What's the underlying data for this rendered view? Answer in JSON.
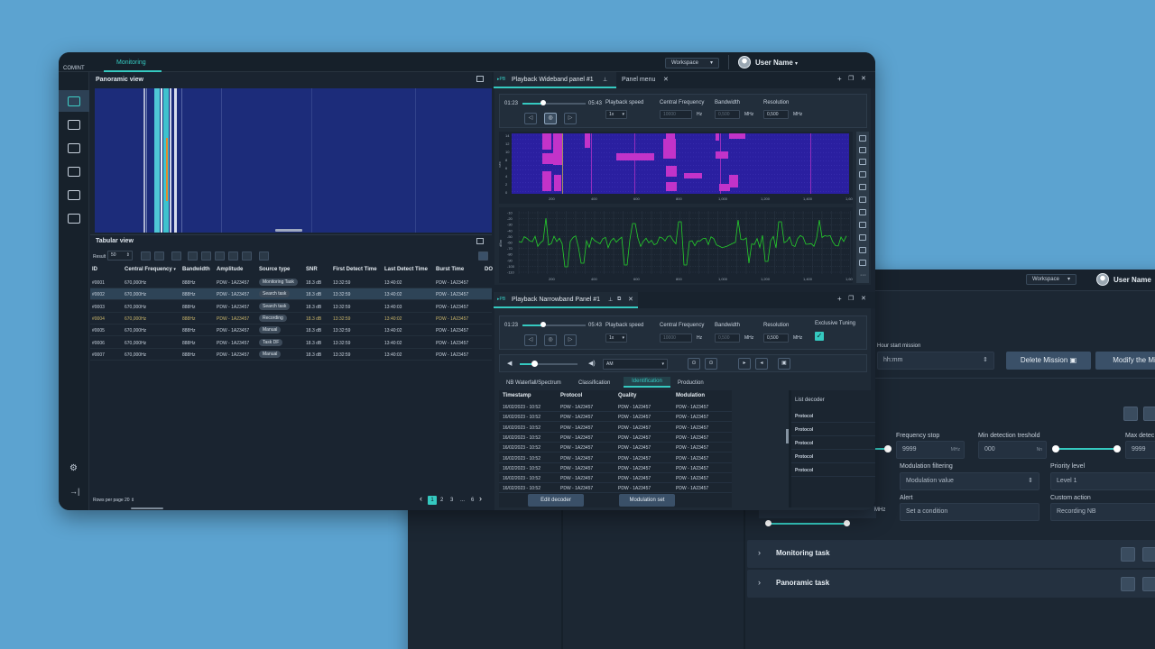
{
  "back": {
    "workspace": "Workspace",
    "user_name": "User Name",
    "hour_label": "Hour start mission",
    "hour_value": "hh:mm",
    "delete_btn": "Delete Mission",
    "modify_btn": "Modify the Mis",
    "freq_stop_label": "Frequency stop",
    "freq_stop_value": "9999",
    "freq_stop_unit": "MHz",
    "min_det_label": "Min detection treshold",
    "min_det_value": "000",
    "min_det_unit": "Nn",
    "max_det_label": "Max detec",
    "max_det_value": "9999",
    "mod_filter_label": "Modulation filtering",
    "mod_filter_value": "Modulation value",
    "priority_label": "Priority level",
    "priority_value": "Level 1",
    "alert_label": "Alert",
    "alert_value": "Set a condition",
    "custom_label": "Custom action",
    "custom_value": "Recording NB",
    "mhz": "MHz",
    "monitoring_task": "Monitoring task",
    "panoramic_task": "Panoramic task"
  },
  "main": {
    "app": "COMINT",
    "tab": "Monitoring",
    "workspace": "Workspace",
    "user_name": "User Name",
    "panoramic_title": "Panoramic view",
    "tabular_title": "Tabular view",
    "result_label": "Result",
    "result_value": "50",
    "columns": [
      "ID",
      "Central Frequency",
      "Bandwidth",
      "Amplitude",
      "Source type",
      "SNR",
      "First Detect Time",
      "Last Detect Time",
      "Burst Time",
      "DO"
    ],
    "rows": [
      {
        "id": "#0001",
        "freq": "670,000Hz",
        "bw": "888Hz",
        "amp": "PDW - 1A23457",
        "src": "Monitoring Task",
        "snr": "18.3 dB",
        "first": "13:32:59",
        "last": "13:40:02",
        "burst": "PDW - 1A23457"
      },
      {
        "id": "#0002",
        "freq": "670,000Hz",
        "bw": "888Hz",
        "amp": "PDW - 1A23457",
        "src": "Search task",
        "snr": "18.3 dB",
        "first": "13:32:59",
        "last": "13:40:02",
        "burst": "PDW - 1A23457"
      },
      {
        "id": "#0003",
        "freq": "670,000Hz",
        "bw": "888Hz",
        "amp": "PDW - 1A23457",
        "src": "Search task",
        "snr": "18.3 dB",
        "first": "13:32:59",
        "last": "13:40:03",
        "burst": "PDW - 1A23457"
      },
      {
        "id": "#0004",
        "freq": "670,000Hz",
        "bw": "888Hz",
        "amp": "PDW - 1A23457",
        "src": "Recording",
        "snr": "18.3 dB",
        "first": "13:32:59",
        "last": "13:40:02",
        "burst": "PDW - 1A23457"
      },
      {
        "id": "#0005",
        "freq": "670,000Hz",
        "bw": "888Hz",
        "amp": "PDW - 1A23457",
        "src": "Manual",
        "snr": "18.3 dB",
        "first": "13:32:59",
        "last": "13:40:02",
        "burst": "PDW - 1A23457"
      },
      {
        "id": "#0006",
        "freq": "670,000Hz",
        "bw": "888Hz",
        "amp": "PDW - 1A23457",
        "src": "Task DF",
        "snr": "18.3 dB",
        "first": "13:32:59",
        "last": "13:40:02",
        "burst": "PDW - 1A23457"
      },
      {
        "id": "#0007",
        "freq": "670,000Hz",
        "bw": "888Hz",
        "amp": "PDW - 1A23457",
        "src": "Manual",
        "snr": "18.3 dB",
        "first": "13:32:59",
        "last": "13:40:02",
        "burst": "PDW - 1A23457"
      }
    ],
    "rows_per_page": "Rows per page 20",
    "pages": [
      "1",
      "2",
      "3",
      "...",
      "6"
    ]
  },
  "wb": {
    "title": "Playback Wideband panel #1",
    "menu_tab": "Panel menu",
    "time_start": "01:23",
    "time_end": "05:43",
    "speed_label": "Playback speed",
    "speed_value": "1x",
    "cf_label": "Central Frequency",
    "cf_value": "10000",
    "cf_unit": "Hz",
    "bw_label": "Bandwidth",
    "bw_value": "0,500",
    "bw_unit": "MHz",
    "res_label": "Resolution",
    "res_value": "0,500",
    "res_unit": "MHz",
    "wf_xticks": [
      "200",
      "400",
      "600",
      "800",
      "1,000",
      "1,200",
      "1,400",
      "1,600"
    ],
    "wf_yticks": [
      "14",
      "12",
      "10",
      "8",
      "6",
      "4",
      "2",
      "0"
    ],
    "wf_ylabel": "Sec",
    "sp_yticks": [
      "-10",
      "-20",
      "-30",
      "-40",
      "-50",
      "-60",
      "-70",
      "-80",
      "-90",
      "-100",
      "-110"
    ],
    "sp_ylabel": "dBm",
    "sp_xticks": [
      "200",
      "400",
      "600",
      "800",
      "1,000",
      "1,200",
      "1,400",
      "1,600"
    ]
  },
  "nb": {
    "title": "Playback Narrowband Panel #1",
    "time_start": "01:23",
    "time_end": "05:43",
    "speed_label": "Playback speed",
    "speed_value": "1x",
    "cf_label": "Central Frequency",
    "cf_value": "10000",
    "cf_unit": "Hz",
    "bw_label": "Bandwidth",
    "bw_value": "0,500",
    "bw_unit": "MHz",
    "res_label": "Resolution",
    "res_value": "0,500",
    "res_unit": "MHz",
    "excl_label": "Exclusive Tuning",
    "mod_value": "AM",
    "tabs": [
      "NB Waterfall/Spectrum",
      "Classification",
      "Identification",
      "Production"
    ],
    "columns": [
      "Timestamp",
      "Protocol",
      "Quality",
      "Modulation"
    ],
    "rows": [
      {
        "ts": "16/02/2023 - 10:52",
        "proto": "PDW - 1A23457",
        "q": "PDW - 1A23457",
        "mod": "PDW - 1A23457"
      },
      {
        "ts": "16/02/2023 - 10:52",
        "proto": "PDW - 1A23457",
        "q": "PDW - 1A23457",
        "mod": "PDW - 1A23457"
      },
      {
        "ts": "16/02/2023 - 10:52",
        "proto": "PDW - 1A23457",
        "q": "PDW - 1A23457",
        "mod": "PDW - 1A23457"
      },
      {
        "ts": "16/02/2023 - 10:52",
        "proto": "PDW - 1A23457",
        "q": "PDW - 1A23457",
        "mod": "PDW - 1A23457"
      },
      {
        "ts": "16/02/2023 - 10:52",
        "proto": "PDW - 1A23457",
        "q": "PDW - 1A23457",
        "mod": "PDW - 1A23457"
      },
      {
        "ts": "16/02/2023 - 10:52",
        "proto": "PDW - 1A23457",
        "q": "PDW - 1A23457",
        "mod": "PDW - 1A23457"
      },
      {
        "ts": "16/02/2023 - 10:52",
        "proto": "PDW - 1A23457",
        "q": "PDW - 1A23457",
        "mod": "PDW - 1A23457"
      },
      {
        "ts": "16/02/2023 - 10:52",
        "proto": "PDW - 1A23457",
        "q": "PDW - 1A23457",
        "mod": "PDW - 1A23457"
      },
      {
        "ts": "16/02/2023 - 10:52",
        "proto": "PDW - 1A23457",
        "q": "PDW - 1A23457",
        "mod": "PDW - 1A23457"
      }
    ],
    "list_title": "List decoder",
    "list": [
      {
        "label": "Protocol",
        "n": "1"
      },
      {
        "label": "Protocol",
        "n": "2"
      },
      {
        "label": "Protocol",
        "n": "3"
      },
      {
        "label": "Protocol",
        "n": "4"
      },
      {
        "label": "Protocol",
        "n": "5"
      }
    ],
    "edit_btn": "Edit decoder",
    "modset_btn": "Modulation set"
  },
  "colors": {
    "accent": "#35c9c0",
    "waterfall_bg": "#2a1fa0",
    "waterfall_signal": "#c233c9",
    "spectrum_line": "#25d02b"
  }
}
